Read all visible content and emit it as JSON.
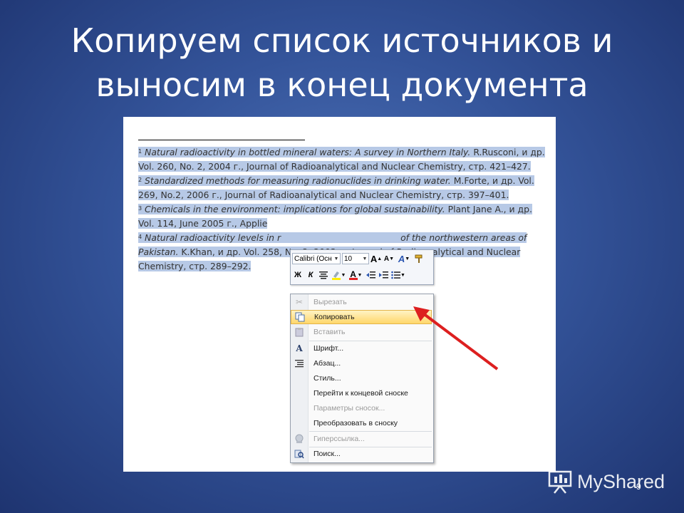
{
  "slide": {
    "title_line1": "Копируем список источников и",
    "title_line2": "выносим в конец документа",
    "page_number": "9",
    "watermark": "MyShared"
  },
  "document": {
    "footnotes": [
      {
        "num": "1",
        "title": "Natural radioactivity in bottled mineral waters: A survey in Northern Italy.",
        "rest": " R.Rusconi, и др. Vol. 260, No. 2, 2004 г., Journal of Radioanalytical and Nuclear Chemistry, стр. 421–427."
      },
      {
        "num": "2",
        "title": "Standardized methods for measuring radionuclides in drinking water.",
        "rest": " M.Forte, и др. Vol. 269, No.2, 2006 г., Journal of Radioanalytical and Nuclear Chemistry, стр. 397–401."
      },
      {
        "num": "3",
        "title": "Chemicals in the environment: implications for global sustainability.",
        "rest": " Plant Jane A., и др. Vol. 114, June 2005 г., Applie"
      },
      {
        "num": "4",
        "title": "Natural radioactivity levels in r",
        "title2": "of the northwestern areas of Pakistan.",
        "rest": " K.Khan, и др. Vol. 258, No. 2, 2003 г., Journal of Radioanalytical and Nuclear Chemistry, стр. 289–292."
      }
    ]
  },
  "minitoolbar": {
    "font_name": "Calibri (Осн",
    "font_size": "10",
    "bold_label": "Ж",
    "italic_label": "К",
    "font_color_label": "A",
    "grow_label": "A",
    "shrink_label": "A",
    "styles_label": "A"
  },
  "context_menu": {
    "items": [
      {
        "label": "Вырезать",
        "icon": "scissors-icon",
        "disabled": true
      },
      {
        "label": "Копировать",
        "icon": "copy-icon",
        "disabled": false,
        "selected": true
      },
      {
        "label": "Вставить",
        "icon": "paste-icon",
        "disabled": true
      },
      {
        "label": "Шрифт...",
        "icon": "font-icon",
        "disabled": false
      },
      {
        "label": "Абзац...",
        "icon": "paragraph-icon",
        "disabled": false
      },
      {
        "label": "Стиль...",
        "disabled": false
      },
      {
        "label": "Перейти к концевой сноске",
        "disabled": false
      },
      {
        "label": "Параметры сносок...",
        "disabled": true
      },
      {
        "label": "Преобразовать в сноску",
        "disabled": false
      },
      {
        "label": "Гиперссылка...",
        "icon": "hyperlink-icon",
        "disabled": true
      },
      {
        "label": "Поиск...",
        "icon": "search-icon",
        "disabled": false
      }
    ]
  },
  "colors": {
    "selection": "#b7c9e6",
    "arrow": "#dd1f1f",
    "menu_highlight": "#ffd76b"
  }
}
